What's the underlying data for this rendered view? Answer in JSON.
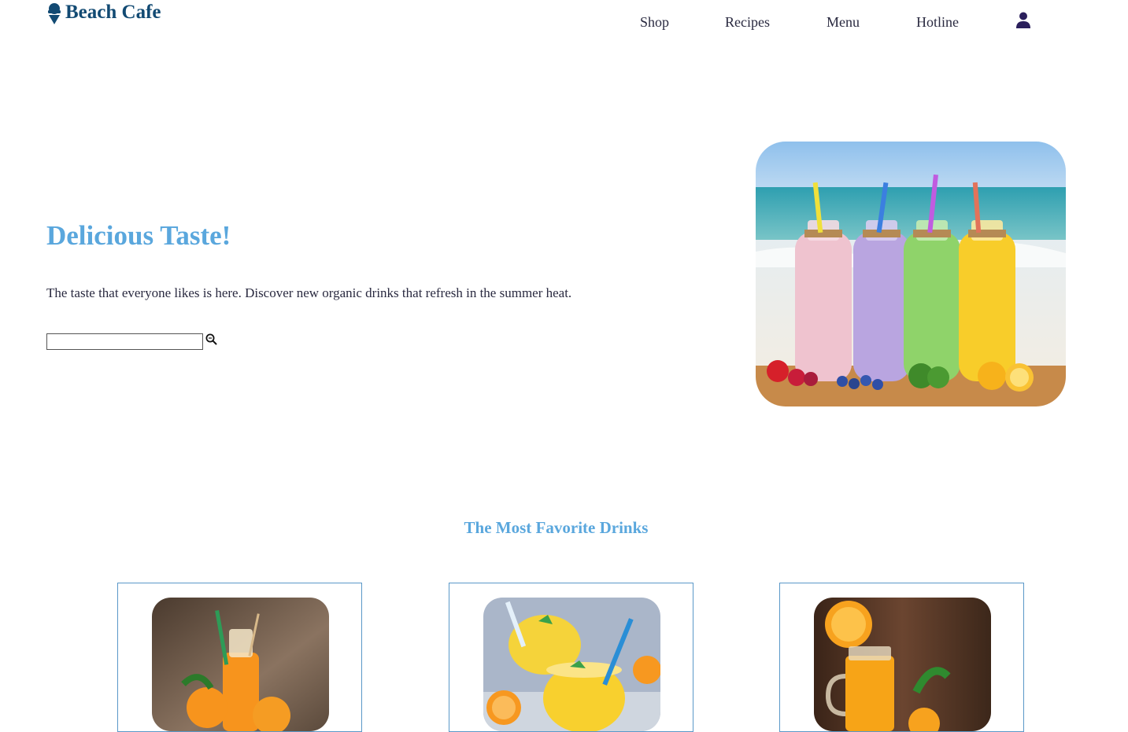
{
  "header": {
    "brand": "Beach Cafe",
    "brand_icon": "ice-cream-icon",
    "brand_color": "#124a73",
    "nav": [
      {
        "label": "Shop"
      },
      {
        "label": "Recipes"
      },
      {
        "label": "Menu"
      },
      {
        "label": "Hotline"
      }
    ],
    "user_icon": "user-icon"
  },
  "hero": {
    "title": "Delicious Taste!",
    "text": "The taste that everyone likes is here. Discover new organic drinks that refresh in the summer heat.",
    "search_placeholder": "",
    "search_icon": "search-icon",
    "accent_color": "#5aa7dd"
  },
  "favorites": {
    "title": "The Most Favorite Drinks"
  }
}
